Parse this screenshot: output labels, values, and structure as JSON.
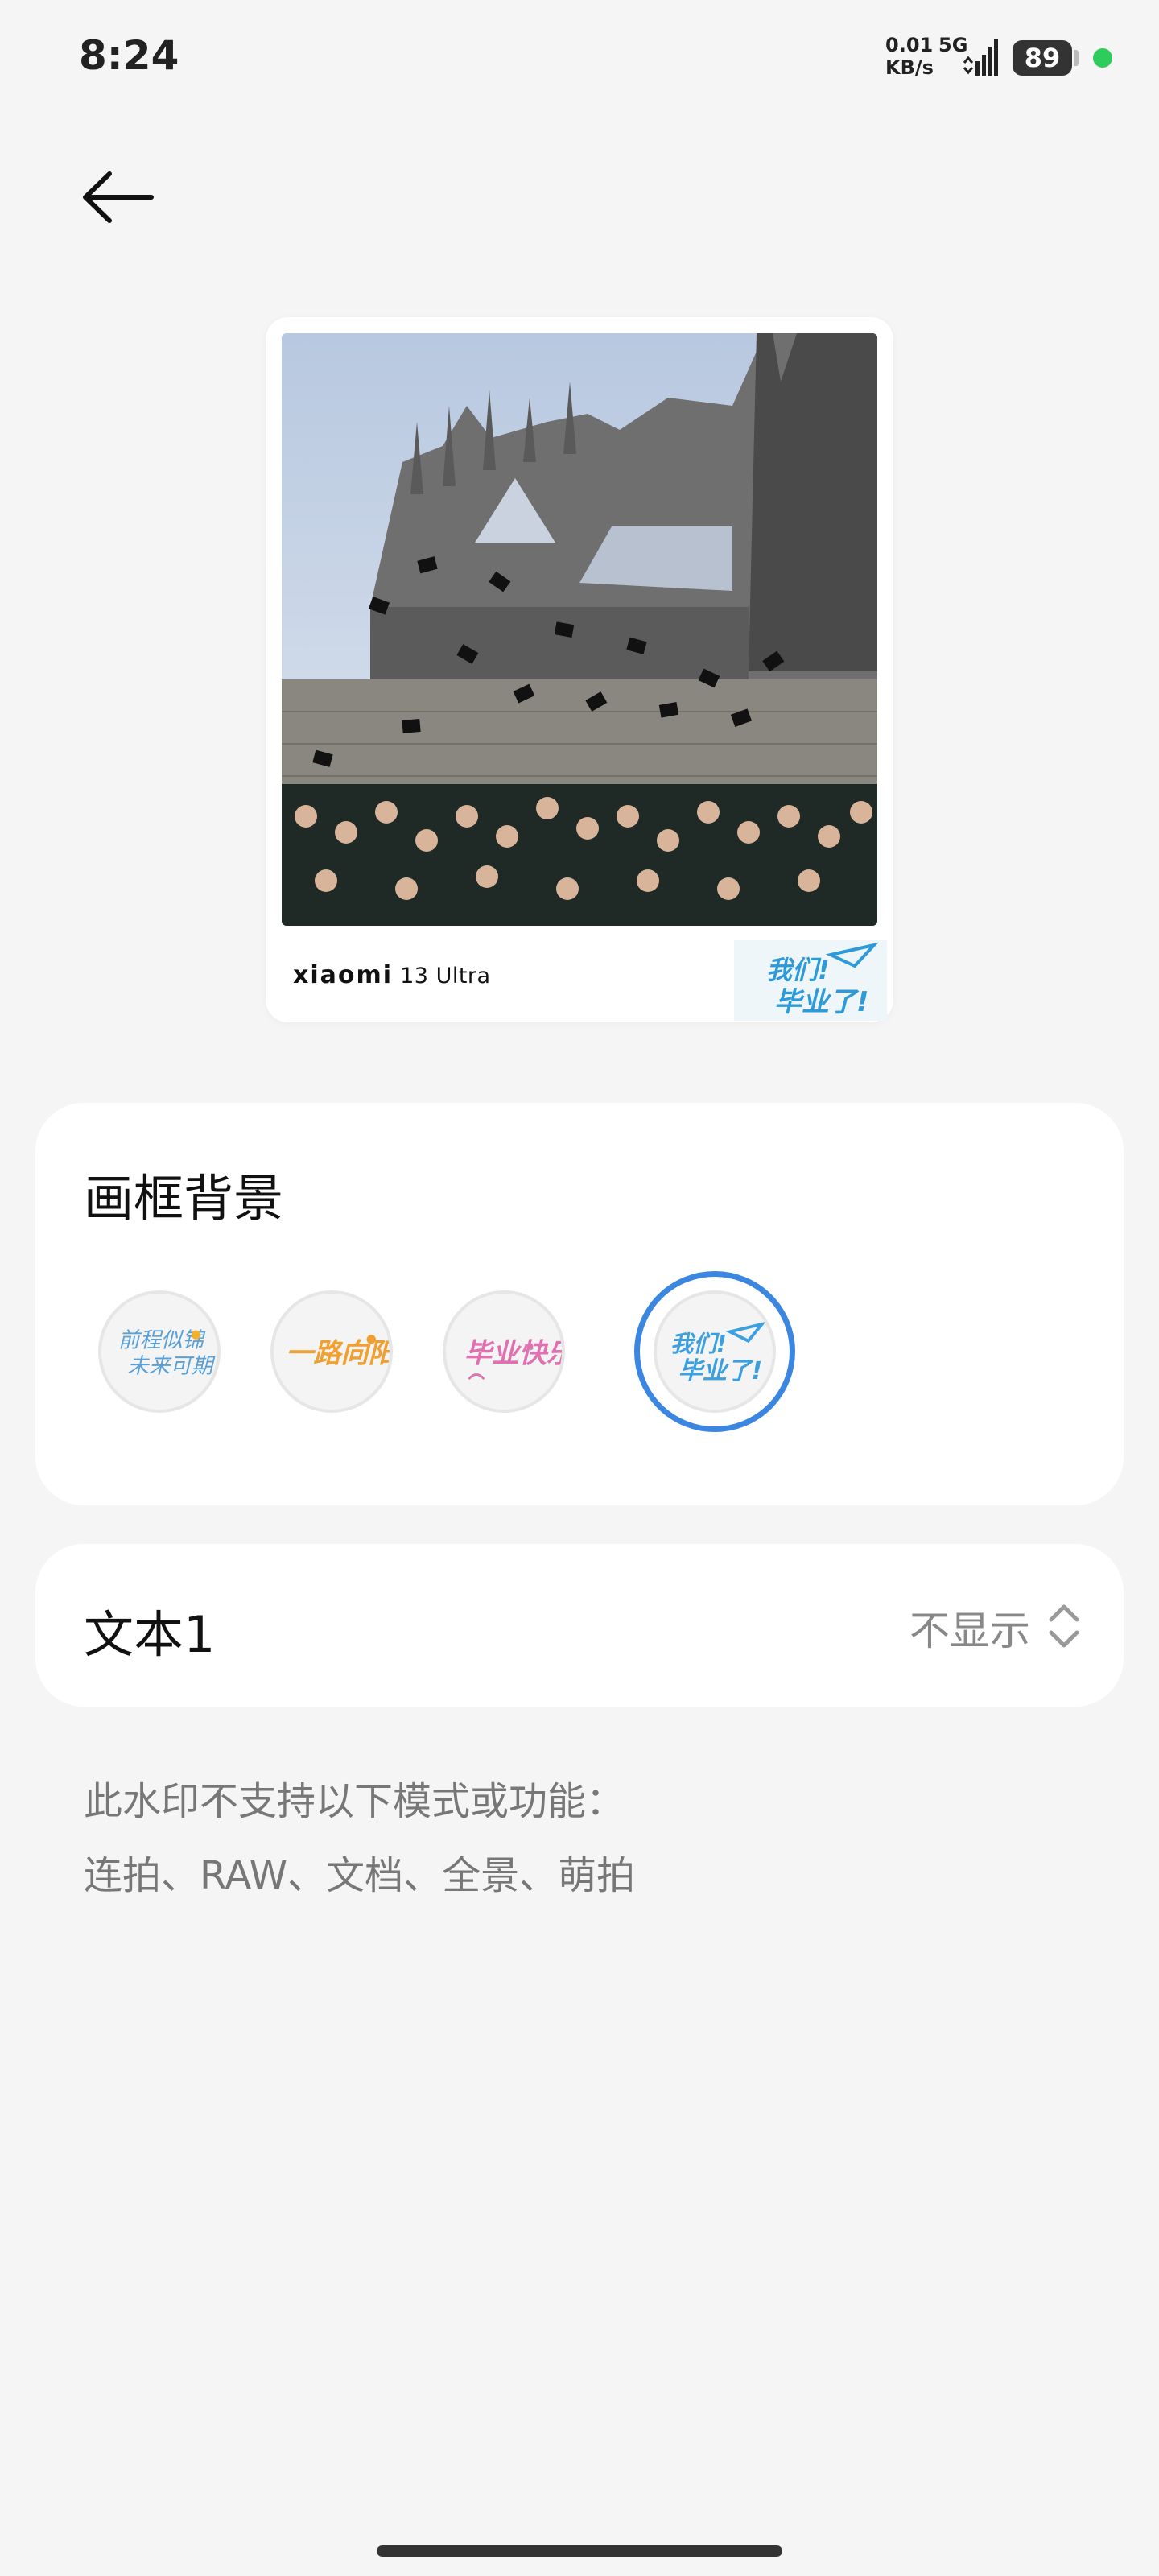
{
  "status_bar": {
    "time": "8:24",
    "net_speed_value": "0.01",
    "net_speed_unit": "KB/s",
    "net_type": "5G",
    "battery": "89"
  },
  "preview": {
    "brand_name": "xiaomi",
    "brand_model": "13 Ultra",
    "watermark_text": "我们！毕业了！"
  },
  "frame_background": {
    "title": "画框背景",
    "options": [
      {
        "text": "前程似锦未来可期",
        "color": "#5aa0d8"
      },
      {
        "text": "一路向阳",
        "color": "#f0a030"
      },
      {
        "text": "毕业快乐",
        "color": "#e070b0"
      },
      {
        "text": "我们！毕业了！",
        "color": "#3ca0e0"
      }
    ],
    "selected_index": 3,
    "accent_color": "#3a86e0"
  },
  "text_setting": {
    "label": "文本1",
    "value": "不显示"
  },
  "note": {
    "line1": "此水印不支持以下模式或功能：",
    "line2": "连拍、RAW、文档、全景、萌拍"
  }
}
